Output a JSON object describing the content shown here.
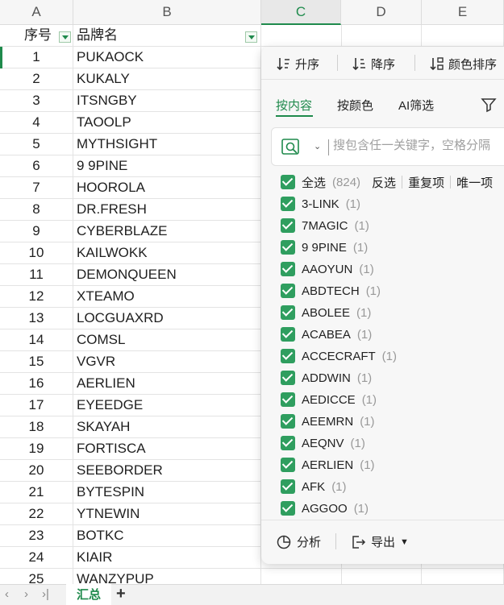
{
  "columns": [
    "A",
    "B",
    "C",
    "D",
    "E"
  ],
  "header_row": {
    "seq": "序号",
    "brand": "品牌名"
  },
  "rows": [
    {
      "n": "1",
      "name": "PUKAOCK"
    },
    {
      "n": "2",
      "name": "KUKALY"
    },
    {
      "n": "3",
      "name": "ITSNGBY"
    },
    {
      "n": "4",
      "name": "TAOOLP"
    },
    {
      "n": "5",
      "name": "MYTHSIGHT"
    },
    {
      "n": "6",
      "name": "9 9PINE"
    },
    {
      "n": "7",
      "name": "HOOROLA"
    },
    {
      "n": "8",
      "name": "DR.FRESH"
    },
    {
      "n": "9",
      "name": "CYBERBLAZE"
    },
    {
      "n": "10",
      "name": "KAILWOKK"
    },
    {
      "n": "11",
      "name": "DEMONQUEEN"
    },
    {
      "n": "12",
      "name": "XTEAMO"
    },
    {
      "n": "13",
      "name": "LOCGUAXRD"
    },
    {
      "n": "14",
      "name": "COMSL"
    },
    {
      "n": "15",
      "name": "VGVR"
    },
    {
      "n": "16",
      "name": "AERLIEN"
    },
    {
      "n": "17",
      "name": "EYEEDGE"
    },
    {
      "n": "18",
      "name": "SKAYAH"
    },
    {
      "n": "19",
      "name": "FORTISCA"
    },
    {
      "n": "20",
      "name": "SEEBORDER"
    },
    {
      "n": "21",
      "name": "BYTESPIN"
    },
    {
      "n": "22",
      "name": "YTNEWIN"
    },
    {
      "n": "23",
      "name": "BOTKC"
    },
    {
      "n": "24",
      "name": "KIAIR"
    },
    {
      "n": "25",
      "name": "WANZYPUP"
    }
  ],
  "sheet_tabs": {
    "active": "汇总",
    "add": "+"
  },
  "filter_panel": {
    "sort_asc": "升序",
    "sort_desc": "降序",
    "sort_color": "颜色排序",
    "tabs": [
      "按内容",
      "按颜色",
      "AI筛选"
    ],
    "search_placeholder": "搜包含任一关键字，空格分隔",
    "select_all": "全选",
    "select_all_count": "(824)",
    "invert": "反选",
    "duplicates": "重复项",
    "unique": "唯一项",
    "items": [
      {
        "label": "3-LINK",
        "count": "(1)"
      },
      {
        "label": "7MAGIC",
        "count": "(1)"
      },
      {
        "label": "9 9PINE",
        "count": "(1)"
      },
      {
        "label": "AAOYUN",
        "count": "(1)"
      },
      {
        "label": "ABDTECH",
        "count": "(1)"
      },
      {
        "label": "ABOLEE",
        "count": "(1)"
      },
      {
        "label": "ACABEA",
        "count": "(1)"
      },
      {
        "label": "ACCECRAFT",
        "count": "(1)"
      },
      {
        "label": "ADDWIN",
        "count": "(1)"
      },
      {
        "label": "AEDICCE",
        "count": "(1)"
      },
      {
        "label": "AEEMRN",
        "count": "(1)"
      },
      {
        "label": "AEQNV",
        "count": "(1)"
      },
      {
        "label": "AERLIEN",
        "count": "(1)"
      },
      {
        "label": "AFK",
        "count": "(1)"
      },
      {
        "label": "AGGOO",
        "count": "(1)"
      }
    ],
    "analyze": "分析",
    "export": "导出"
  },
  "colors": {
    "accent": "#1f8a4c",
    "checkbox": "#2f9e5f"
  }
}
